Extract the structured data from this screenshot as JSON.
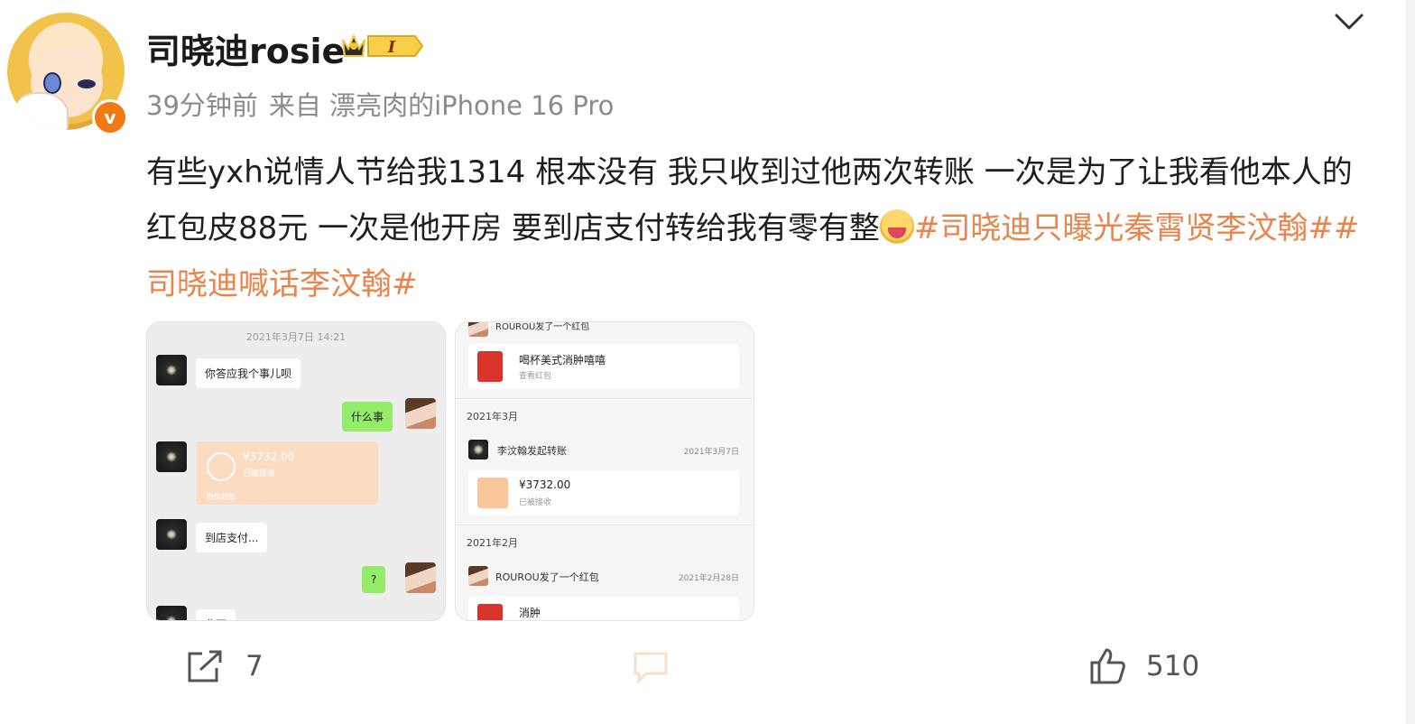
{
  "post": {
    "author": "司晓迪rosie",
    "vip_badge_text": "I",
    "time": "39分钟前",
    "source": "来自 漂亮肉的iPhone 16 Pro",
    "text": "有些yxh说情人节给我1314 根本没有 我只收到过他两次转账 一次是为了让我看他本人的红包皮88元 一次是他开房 要到店支付转给我有零有整",
    "hashtags": [
      "#司晓迪只曝光秦霄贤李汶翰#",
      "#司晓迪喊话李汶翰#"
    ]
  },
  "images": {
    "left": {
      "timestamp": "2021年3月7日 14:21",
      "messages": [
        {
          "side": "left",
          "text": "你答应我个事儿呗"
        },
        {
          "side": "right",
          "text": "什么事"
        },
        {
          "side": "left",
          "text": "到店支付..."
        },
        {
          "side": "right",
          "text": "?"
        },
        {
          "side": "left",
          "text": "收下"
        }
      ],
      "transfer": {
        "amount": "¥3732.00",
        "status": "已被接收",
        "footer": "微信转账"
      }
    },
    "right": {
      "top_sender": "ROUROU发了一个红包",
      "card1": {
        "title": "喝杯美式消肿嘻嘻",
        "sub": "查看红包"
      },
      "month1": "2021年3月",
      "row2": {
        "sender": "李汶翰发起转账",
        "date": "2021年3月7日"
      },
      "card2": {
        "title": "¥3732.00",
        "sub": "已被接收"
      },
      "month2": "2021年2月",
      "row3": {
        "sender": "ROUROU发了一个红包",
        "date": "2021年2月28日"
      },
      "card3": {
        "title": "消肿"
      }
    }
  },
  "actions": {
    "repost": "7",
    "comment": "",
    "like": "510"
  },
  "colors": {
    "hashtag": "#e8844c",
    "meta": "#8b8b8b",
    "verified": "#f07b14"
  }
}
